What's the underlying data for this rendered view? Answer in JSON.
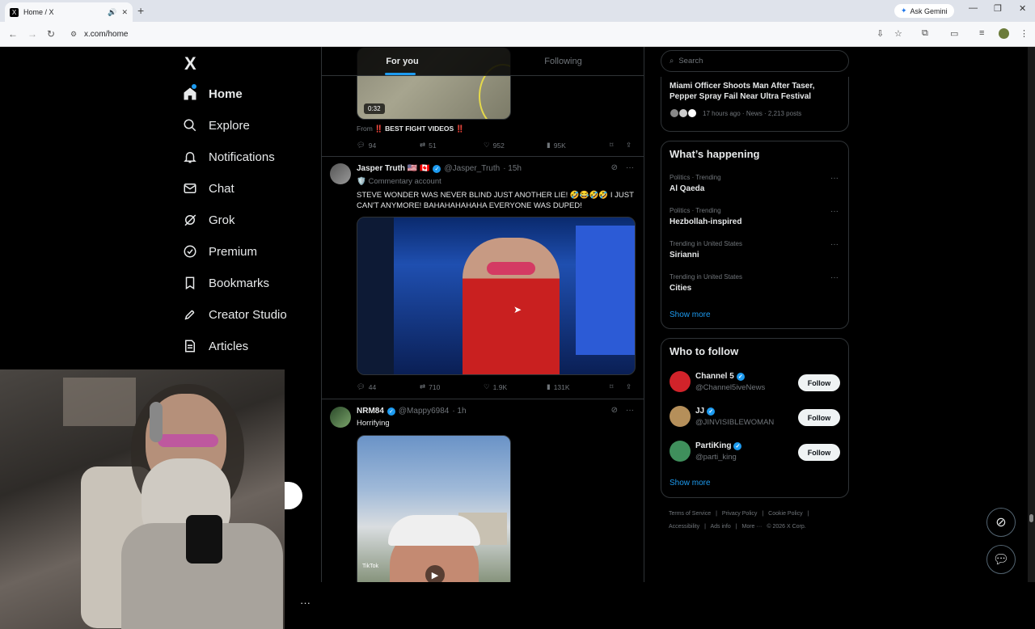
{
  "browser": {
    "tab_title": "Home / X",
    "tab_favicon": "X",
    "ask_gemini": "Ask Gemini",
    "url": "x.com/home"
  },
  "sidebar": {
    "logo": "X",
    "items": [
      {
        "label": "Home",
        "icon": "home-icon"
      },
      {
        "label": "Explore",
        "icon": "search-icon"
      },
      {
        "label": "Notifications",
        "icon": "bell-icon"
      },
      {
        "label": "Chat",
        "icon": "mail-icon"
      },
      {
        "label": "Grok",
        "icon": "grok-icon"
      },
      {
        "label": "Premium",
        "icon": "verified-icon"
      },
      {
        "label": "Bookmarks",
        "icon": "bookmark-icon"
      },
      {
        "label": "Creator Studio",
        "icon": "rocket-icon"
      },
      {
        "label": "Articles",
        "icon": "article-icon"
      }
    ]
  },
  "feed": {
    "tabs": [
      "For you",
      "Following"
    ],
    "post1": {
      "duration": "0:32",
      "from_prefix": "From",
      "from_source": "‼️ BEST FIGHT VIDEOS ‼️",
      "replies": "94",
      "reposts": "51",
      "likes": "952",
      "views": "95K"
    },
    "post2": {
      "name": "Jasper Truth 🇺🇸 🇨🇦",
      "handle": "@Jasper_Truth",
      "time": "· 15h",
      "commentary": "🛡️ Commentary account",
      "text": "STEVE WONDER WAS NEVER BLIND JUST ANOTHER LIE! 🤣😂🤣🤣 I JUST CAN'T ANYMORE! BAHAHAHAHAHA EVERYONE WAS DUPED!",
      "replies": "44",
      "reposts": "710",
      "likes": "1.9K",
      "views": "131K"
    },
    "post3": {
      "name": "NRM84",
      "handle": "@Mappy6984",
      "time": "· 1h",
      "text": "Horrifying",
      "watermark": "TikTok"
    }
  },
  "right": {
    "search_placeholder": "Search",
    "news": {
      "title": "Miami Officer Shoots Man After Taser, Pepper Spray Fail Near Ultra Festival",
      "meta": "17 hours ago · News · 2,213 posts"
    },
    "whats_happening": {
      "title": "What’s happening",
      "trends": [
        {
          "category": "Politics · Trending",
          "name": "Al Qaeda"
        },
        {
          "category": "Politics · Trending",
          "name": "Hezbollah-inspired"
        },
        {
          "category": "Trending in United States",
          "name": "Sirianni"
        },
        {
          "category": "Trending in United States",
          "name": "Cities"
        }
      ],
      "show_more": "Show more"
    },
    "who_to_follow": {
      "title": "Who to follow",
      "accounts": [
        {
          "name": "Channel 5",
          "handle": "@Channel5iveNews",
          "button": "Follow",
          "avatar_color": "#d1232a"
        },
        {
          "name": "JJ",
          "handle": "@JINVISIBLEWOMAN",
          "button": "Follow",
          "avatar_color": "#b58f5a"
        },
        {
          "name": "PartiKing",
          "handle": "@parti_king",
          "button": "Follow",
          "avatar_color": "#3f8f5c"
        }
      ],
      "show_more": "Show more"
    },
    "footer": [
      "Terms of Service",
      "|",
      "Privacy Policy",
      "|",
      "Cookie Policy",
      "|",
      "Accessibility",
      "|",
      "Ads info",
      "|",
      "More ···",
      "© 2026 X Corp."
    ]
  },
  "colors": {
    "accent": "#1d9bf0",
    "background": "#000000",
    "border": "#2f3336",
    "muted": "#71767b"
  }
}
